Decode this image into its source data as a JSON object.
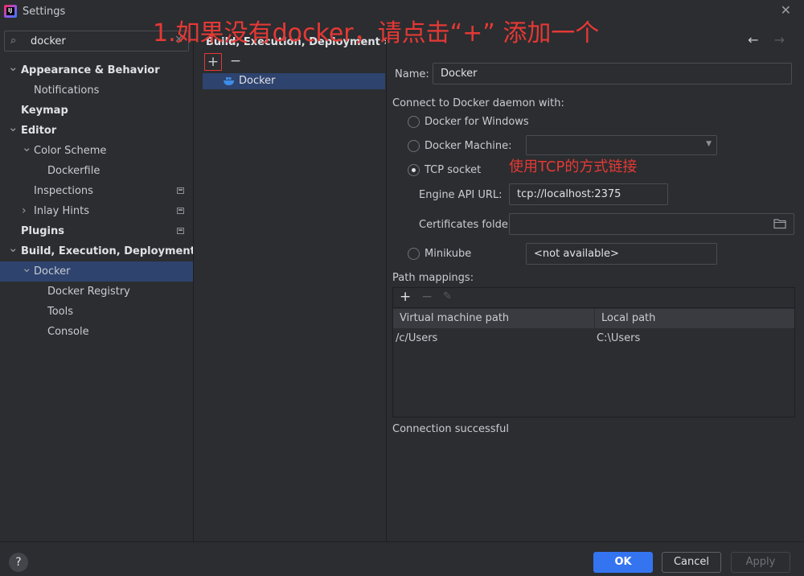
{
  "window": {
    "title": "Settings"
  },
  "search": {
    "value": "docker"
  },
  "tree": [
    {
      "label": "Appearance & Behavior",
      "bold": true,
      "arrow": "expanded",
      "indent": 0
    },
    {
      "label": "Notifications",
      "bold": false,
      "arrow": "none",
      "indent": 1
    },
    {
      "label": "Keymap",
      "bold": true,
      "arrow": "none",
      "indent": 0
    },
    {
      "label": "Editor",
      "bold": true,
      "arrow": "expanded",
      "indent": 0
    },
    {
      "label": "Color Scheme",
      "bold": false,
      "arrow": "expanded",
      "indent": 1
    },
    {
      "label": "Dockerfile",
      "bold": false,
      "arrow": "none",
      "indent": 2
    },
    {
      "label": "Inspections",
      "bold": false,
      "arrow": "none",
      "indent": 1,
      "projectIcon": true
    },
    {
      "label": "Inlay Hints",
      "bold": false,
      "arrow": "collapsed",
      "indent": 1,
      "projectIcon": true
    },
    {
      "label": "Plugins",
      "bold": true,
      "arrow": "none",
      "indent": 0,
      "projectIcon": true
    },
    {
      "label": "Build, Execution, Deployment",
      "bold": true,
      "arrow": "expanded",
      "indent": 0
    },
    {
      "label": "Docker",
      "bold": false,
      "arrow": "expanded",
      "indent": 1,
      "selected": true
    },
    {
      "label": "Docker Registry",
      "bold": false,
      "arrow": "none",
      "indent": 2
    },
    {
      "label": "Tools",
      "bold": false,
      "arrow": "none",
      "indent": 2
    },
    {
      "label": "Console",
      "bold": false,
      "arrow": "none",
      "indent": 2
    }
  ],
  "breadcrumb": "Build, Execution, Deployment  ›  Docker",
  "middle": {
    "add_glyph": "+",
    "remove_glyph": "−",
    "items": [
      "Docker"
    ]
  },
  "form": {
    "name_label": "Name:",
    "name_value": "Docker",
    "connect_label": "Connect to Docker daemon with:",
    "opt_windows": "Docker for Windows",
    "opt_machine": "Docker Machine:",
    "opt_tcp": "TCP socket",
    "opt_minikube": "Minikube",
    "selected_option": "tcp",
    "engine_label": "Engine API URL:",
    "engine_value": "tcp://localhost:2375",
    "cert_label": "Certificates folder:",
    "cert_value": "",
    "minikube_value": "<not available>",
    "path_label": "Path mappings:",
    "status": "Connection successful"
  },
  "path_mappings": {
    "columns": [
      "Virtual machine path",
      "Local path"
    ],
    "rows": [
      [
        "/c/Users",
        "C:\\Users"
      ]
    ]
  },
  "annotations": {
    "top": "1.如果没有docker，请点击“+” 添加一个",
    "tcp": "使用TCP的方式链接"
  },
  "buttons": {
    "ok": "OK",
    "cancel": "Cancel",
    "apply": "Apply",
    "help": "?"
  },
  "colors": {
    "accent": "#3574f0",
    "selection": "#2e436e",
    "annotation": "#e53935"
  }
}
